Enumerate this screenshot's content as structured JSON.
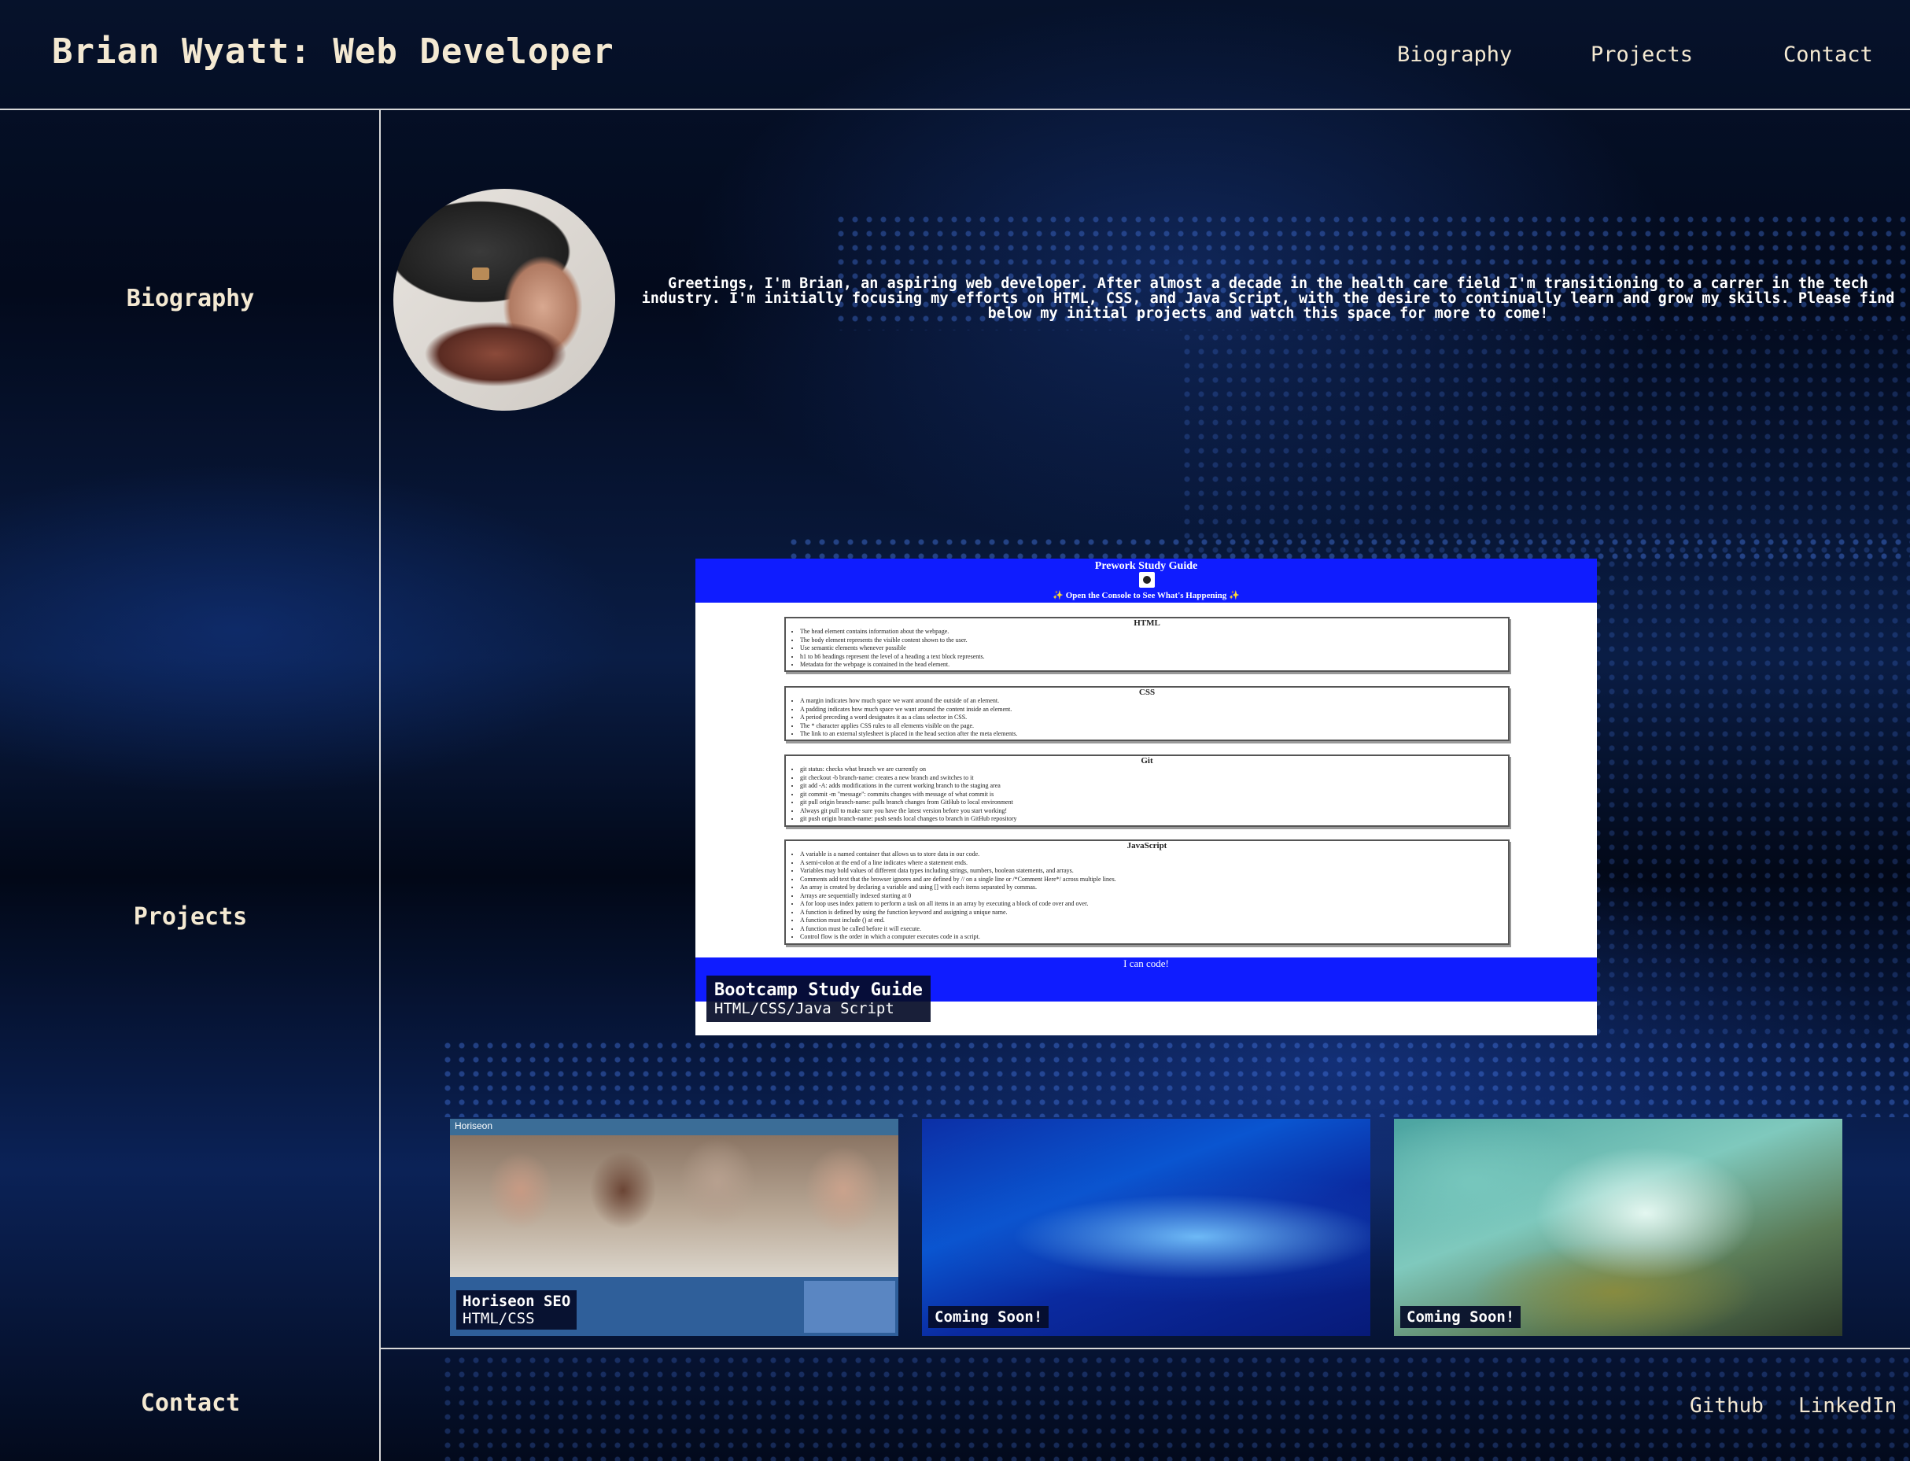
{
  "header": {
    "title": "Brian Wyatt: Web Developer",
    "nav": [
      "Biography",
      "Projects",
      "Contact"
    ]
  },
  "sidebar": {
    "items": [
      "Biography",
      "Projects",
      "Contact"
    ]
  },
  "bio": {
    "text": "Greetings, I'm Brian, an aspiring web developer. After almost a decade in the health care field I'm transitioning to a carrer in the tech industry. I'm initially focusing my efforts on HTML, CSS, and Java Script, with the desire to continually learn and grow my skills. Please find below my initial projects and watch this space for more to come!"
  },
  "featured_project": {
    "screenshot": {
      "heading": "Prework Study Guide",
      "subheading": "✨ Open the Console to See What's Happening ✨",
      "sections": [
        {
          "title": "HTML",
          "items": [
            "The head element contains information about the webpage.",
            "The body element represents the visible content shown to the user.",
            "Use semantic elements whenever possible",
            "h1 to h6 headings represent the level of a heading a text block represents.",
            "Metadata for the webpage is contained in the head element."
          ]
        },
        {
          "title": "CSS",
          "items": [
            "A margin indicates how much space we want around the outside of an element.",
            "A padding indicates how much space we want around the content inside an element.",
            "A period preceding a word designates it as a class selector in CSS.",
            "The * character applies CSS rules to all elements visible on the page.",
            "The link to an external stylesheet is placed in the head section after the meta elements."
          ]
        },
        {
          "title": "Git",
          "items": [
            "git status: checks what branch we are currently on",
            "git checkout -b branch-name: creates a new branch and switches to it",
            "git add -A: adds modifications in the current working branch to the staging area",
            "git commit -m \"message\": commits changes with message of what commit is",
            "git pull origin branch-name: pulls branch changes from GitHub to local environment",
            "Always git pull to make sure you have the latest version before you start working!",
            "git push origin branch-name: push sends local changes to branch in GitHub repository"
          ]
        },
        {
          "title": "JavaScript",
          "items": [
            "A variable is a named container that allows us to store data in our code.",
            "A semi-colon at the end of a line indicates where a statement ends.",
            "Variables may hold values of different data types including strings, numbers, boolean statements, and arrays.",
            "Comments add text that the browser ignores and are defined by // on a single line or /*Comment Here*/ across multiple lines.",
            "An array is created by declaring a variable and using [] with each items separated by commas.",
            "Arrays are sequentially indexed starting at 0",
            "A for loop uses index pattern to perform a task on all items in an array by executing a block of code over and over.",
            "A function is defined by using the function keyword and assigning a unique name.",
            "A function must include () at end.",
            "A function must be called before it will execute.",
            "Control flow is the order in which a computer executes code in a script."
          ]
        }
      ],
      "footer": "I can code!"
    },
    "title": "Bootcamp Study Guide",
    "subtitle": "HTML/CSS/Java Script"
  },
  "projects": [
    {
      "title": "Horiseon SEO",
      "subtitle": "HTML/CSS",
      "brand": "Horiseon"
    },
    {
      "title": "Coming Soon!"
    },
    {
      "title": "Coming Soon!"
    }
  ],
  "footer": {
    "links": [
      "Github",
      "LinkedIn"
    ]
  },
  "colors": {
    "text": "#f4e9d2",
    "background": "#030a1c",
    "study_blue": "#0f1cff",
    "divider": "#d8d8d8"
  }
}
